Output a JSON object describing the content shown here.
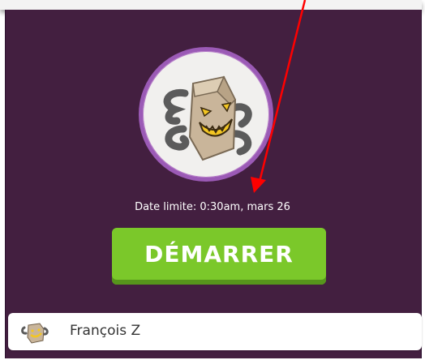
{
  "assignment": {
    "deadline_text": "Date limite: 0:30am, mars 26",
    "start_label": "DÉMARRER"
  },
  "student": {
    "name": "François Z"
  },
  "colors": {
    "panel_bg": "#431f40",
    "avatar_ring": "#9b5ab6",
    "button_green": "#7bc82a",
    "annotation_arrow": "#ff0000"
  },
  "icons": {
    "avatar": "box-monster-icon",
    "student_avatar": "box-monster-small-icon",
    "annotation": "red-arrow-annotation"
  }
}
